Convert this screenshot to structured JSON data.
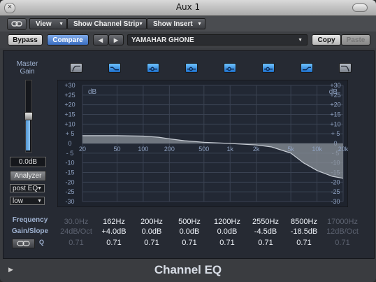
{
  "window": {
    "title": "Aux 1",
    "close_symbol": "×"
  },
  "toolbar1": {
    "link_icon": "link-icon",
    "view_label": "View",
    "strip_label": "Show Channel Strip",
    "insert_label": "Show Insert",
    "arrow": "▼"
  },
  "toolbar2": {
    "bypass_label": "Bypass",
    "compare_label": "Compare",
    "prev_symbol": "◀",
    "next_symbol": "▶",
    "preset_name": "YAMAHAR GHONE",
    "copy_label": "Copy",
    "paste_label": "Paste"
  },
  "master_gain": {
    "label_line1": "Master",
    "label_line2": "Gain",
    "value": "0.0dB",
    "level_fraction": 0.5
  },
  "analyzer": {
    "button_label": "Analyzer",
    "mode": "post EQ",
    "resolution": "low",
    "arrow": "▼"
  },
  "band_buttons": [
    {
      "icon": "lowcut-icon",
      "active": false
    },
    {
      "icon": "lowshelf-icon",
      "active": true
    },
    {
      "icon": "bell-icon",
      "active": true
    },
    {
      "icon": "bell-icon",
      "active": true
    },
    {
      "icon": "bell-icon",
      "active": true
    },
    {
      "icon": "bell-icon",
      "active": true
    },
    {
      "icon": "highshelf-icon",
      "active": true
    },
    {
      "icon": "highcut-icon",
      "active": false
    }
  ],
  "graph": {
    "db_label": "dB",
    "y_ticks": [
      "+30",
      "+25",
      "+20",
      "+15",
      "+10",
      "+ 5",
      "0",
      "- 5",
      "-10",
      "-15",
      "-20",
      "-25",
      "-30"
    ],
    "x_ticks": [
      "20",
      "50",
      "100",
      "200",
      "500",
      "1k",
      "2k",
      "5k",
      "10k",
      "20k"
    ],
    "response_curve": [
      {
        "freq": 20,
        "db": 4
      },
      {
        "freq": 50,
        "db": 4
      },
      {
        "freq": 100,
        "db": 3.8
      },
      {
        "freq": 150,
        "db": 3.2
      },
      {
        "freq": 200,
        "db": 2.4
      },
      {
        "freq": 300,
        "db": 1.4
      },
      {
        "freq": 500,
        "db": 0.6
      },
      {
        "freq": 1000,
        "db": 0
      },
      {
        "freq": 2000,
        "db": -0.8
      },
      {
        "freq": 3000,
        "db": -1.8
      },
      {
        "freq": 5000,
        "db": -5
      },
      {
        "freq": 7000,
        "db": -10
      },
      {
        "freq": 10000,
        "db": -14
      },
      {
        "freq": 15000,
        "db": -17
      },
      {
        "freq": 20000,
        "db": -18
      }
    ],
    "colors": {
      "grid": "#3a4252",
      "curve_fill": "#8a9098",
      "curve_line": "#c8cdd5",
      "tick_text": "#8fa2c2"
    }
  },
  "bands": [
    {
      "freq": "30.0Hz",
      "gain": "24dB/Oct",
      "q": "0.71",
      "active": false
    },
    {
      "freq": "162Hz",
      "gain": "+4.0dB",
      "q": "0.71",
      "active": true
    },
    {
      "freq": "200Hz",
      "gain": "0.0dB",
      "q": "0.71",
      "active": true
    },
    {
      "freq": "500Hz",
      "gain": "0.0dB",
      "q": "0.71",
      "active": true
    },
    {
      "freq": "1200Hz",
      "gain": "0.0dB",
      "q": "0.71",
      "active": true
    },
    {
      "freq": "2550Hz",
      "gain": "-4.5dB",
      "q": "0.71",
      "active": true
    },
    {
      "freq": "8500Hz",
      "gain": "-18.5dB",
      "q": "0.71",
      "active": true
    },
    {
      "freq": "17000Hz",
      "gain": "12dB/Oct",
      "q": "0.71",
      "active": false
    }
  ],
  "row_labels": {
    "frequency": "Frequency",
    "gain_slope": "Gain/Slope",
    "q": "Q"
  },
  "footer": {
    "title": "Channel EQ",
    "disclosure": "▶"
  }
}
